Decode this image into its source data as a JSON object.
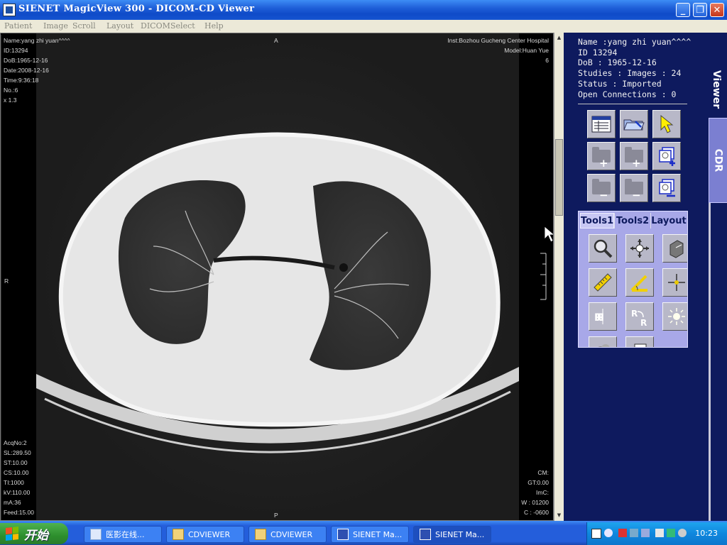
{
  "window": {
    "title": "SIENET MagicView 300  - DICOM-CD Viewer"
  },
  "menu": [
    {
      "label": "Patient"
    },
    {
      "label": "Image"
    },
    {
      "label": "Scroll"
    },
    {
      "label": "Layout"
    },
    {
      "label": "DICOM"
    },
    {
      "label": "Select"
    },
    {
      "label": "Help"
    }
  ],
  "overlay": {
    "top_left": [
      "Name:yang zhi yuan^^^^",
      "ID:13294",
      "DoB:1965-12-16",
      "Date:2008-12-16",
      "Time:9:36:18",
      "No.:6",
      "x 1.3"
    ],
    "top_center": "A",
    "top_right": [
      "Inst:Bozhou Gucheng Center Hospital",
      "Model:Huan Yue",
      "6"
    ],
    "left_center": "R",
    "bottom_center": "P",
    "bottom_left": [
      "AcqNo:2",
      "SL:289.50",
      "ST:10.00",
      "CS:10.00",
      "TI:1000",
      "kV:110.00",
      "mA:36",
      "Feed:15.00"
    ],
    "bottom_right": [
      "CM:",
      "GT:0.00",
      "ImC:",
      "W : 01200",
      "C : -0600"
    ]
  },
  "patient_info": {
    "name": "Name :yang zhi yuan^^^^",
    "id": "ID 13294",
    "dob": "DoB : 1965-12-16",
    "studies": "Studies : Images : 24",
    "status": "Status : Imported",
    "connections": "Open Connections : 0"
  },
  "side_tabs": {
    "viewer": "Viewer",
    "cdr": "CDR"
  },
  "tool_tabs": [
    "Tools1",
    "Tools2",
    "Layout"
  ],
  "taskbar": {
    "start_label": "开始",
    "tasks": [
      {
        "label": "医影在线..."
      },
      {
        "label": "CDVIEWER"
      },
      {
        "label": "CDVIEWER"
      },
      {
        "label": "SIENET Ma..."
      },
      {
        "label": "SIENET Ma..."
      }
    ],
    "clock": "10:23"
  },
  "colors": {
    "panel_bg": "#0e1a5e",
    "tools_bg": "#a8a8e8",
    "titlebar": "#0f4bc8",
    "taskbar": "#245edb"
  },
  "icons": [
    "study-list-icon",
    "open-folder-icon",
    "pointer-icon",
    "add-folder-icon",
    "add-series-icon",
    "add-image-icon",
    "remove-folder-icon",
    "remove-series-icon",
    "remove-image-icon",
    "magnifier-icon",
    "pan-icon",
    "window-level-icon",
    "ruler-icon",
    "angle-icon",
    "crosshair-icon",
    "flip-horizontal-icon",
    "rotate-icon",
    "brightness-icon"
  ]
}
